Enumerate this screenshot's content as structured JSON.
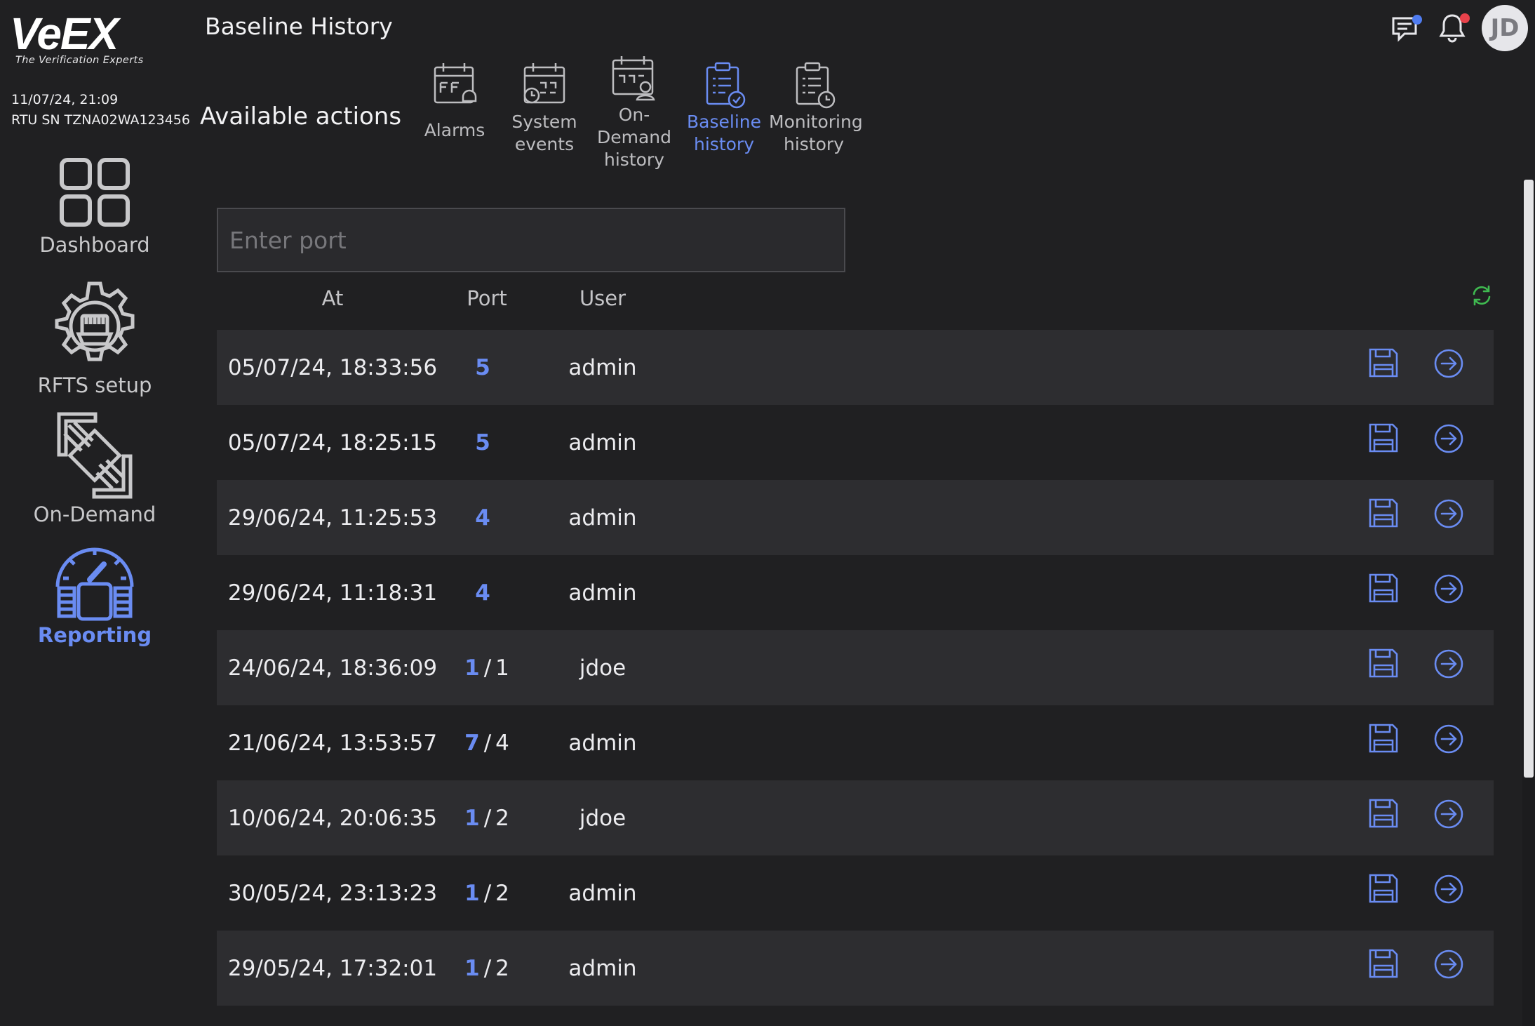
{
  "brand": {
    "logo_text": "VeEX",
    "tagline": "The Verification Experts"
  },
  "device": {
    "datetime": "11/07/24, 21:09",
    "rtu_sn": "RTU SN TZNA02WA123456"
  },
  "page": {
    "title": "Baseline History",
    "actions_title": "Available actions"
  },
  "header": {
    "avatar_initials": "JD",
    "icons": [
      "chat-icon",
      "bell-icon"
    ],
    "chat_dot_color": "#4f7cf0",
    "bell_dot_color": "#e8424b"
  },
  "sidebar": {
    "items": [
      {
        "label": "Dashboard",
        "icon": "dashboard-icon",
        "active": false
      },
      {
        "label": "RFTS setup",
        "icon": "rfts-gear-icon",
        "active": false
      },
      {
        "label": "On-Demand",
        "icon": "on-demand-icon",
        "active": false
      },
      {
        "label": "Reporting",
        "icon": "reporting-gauge-icon",
        "active": true
      }
    ]
  },
  "tabs": [
    {
      "label": "Alarms",
      "icon": "alarms-calendar-icon",
      "active": false
    },
    {
      "label": "System events",
      "icon": "system-events-calendar-icon",
      "active": false
    },
    {
      "label": "On-Demand history",
      "icon": "on-demand-history-icon",
      "active": false
    },
    {
      "label": "Baseline history",
      "icon": "baseline-history-icon",
      "active": true
    },
    {
      "label": "Monitoring history",
      "icon": "monitoring-history-icon",
      "active": false
    }
  ],
  "search": {
    "placeholder": "Enter port",
    "value": ""
  },
  "table": {
    "columns": [
      "At",
      "Port",
      "User"
    ],
    "rows": [
      {
        "at": "05/07/24, 18:33:56",
        "port": "5",
        "port_sub": "",
        "user": "admin"
      },
      {
        "at": "05/07/24, 18:25:15",
        "port": "5",
        "port_sub": "",
        "user": "admin"
      },
      {
        "at": "29/06/24, 11:25:53",
        "port": "4",
        "port_sub": "",
        "user": "admin"
      },
      {
        "at": "29/06/24, 11:18:31",
        "port": "4",
        "port_sub": "",
        "user": "admin"
      },
      {
        "at": "24/06/24, 18:36:09",
        "port": "1",
        "port_sub": "1",
        "user": "jdoe"
      },
      {
        "at": "21/06/24, 13:53:57",
        "port": "7",
        "port_sub": "4",
        "user": "admin"
      },
      {
        "at": "10/06/24, 20:06:35",
        "port": "1",
        "port_sub": "2",
        "user": "jdoe"
      },
      {
        "at": "30/05/24, 23:13:23",
        "port": "1",
        "port_sub": "2",
        "user": "admin"
      },
      {
        "at": "29/05/24, 17:32:01",
        "port": "1",
        "port_sub": "2",
        "user": "admin"
      }
    ]
  },
  "colors": {
    "background": "#202022",
    "row_alt": "#2d2d30",
    "accent": "#6a8cf2",
    "refresh": "#3fb950"
  }
}
